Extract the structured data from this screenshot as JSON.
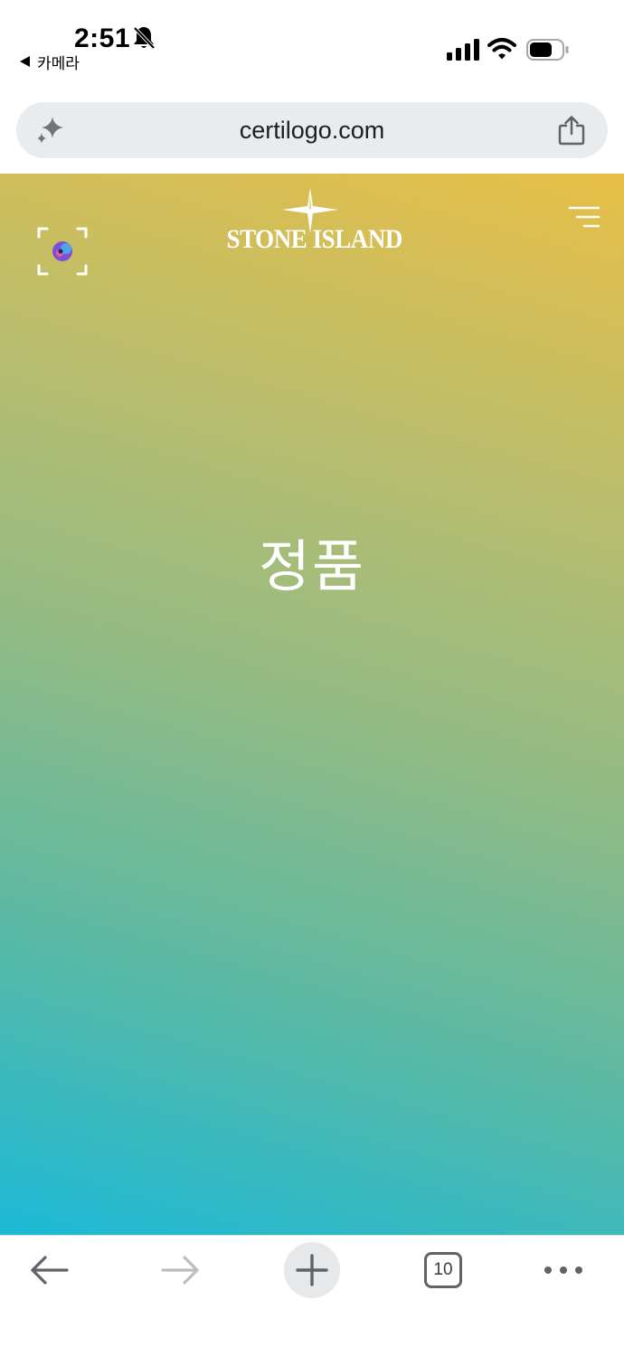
{
  "status_bar": {
    "time": "2:51",
    "back_app_label": "카메라",
    "icons": [
      "bell-slash-icon",
      "cellular-signal-icon",
      "wifi-icon",
      "battery-icon"
    ]
  },
  "browser": {
    "url": "certilogo.com",
    "icons": [
      "sparkle-icon",
      "share-icon"
    ]
  },
  "page": {
    "brand": {
      "name": "STONE ISLAND",
      "logo_icon": "compass-rose-icon"
    },
    "headline": "정품",
    "icons": [
      "scan-icon",
      "menu-icon"
    ],
    "colors": {
      "gradient_top": "#e8bf47",
      "gradient_middle": "#93bb84",
      "gradient_bottom": "#1cb9d6",
      "text": "#ffffff"
    }
  },
  "toolbar": {
    "tab_count": "10",
    "icons": [
      "back-arrow-icon",
      "forward-arrow-icon",
      "plus-icon",
      "tabs-icon",
      "more-icon"
    ]
  }
}
